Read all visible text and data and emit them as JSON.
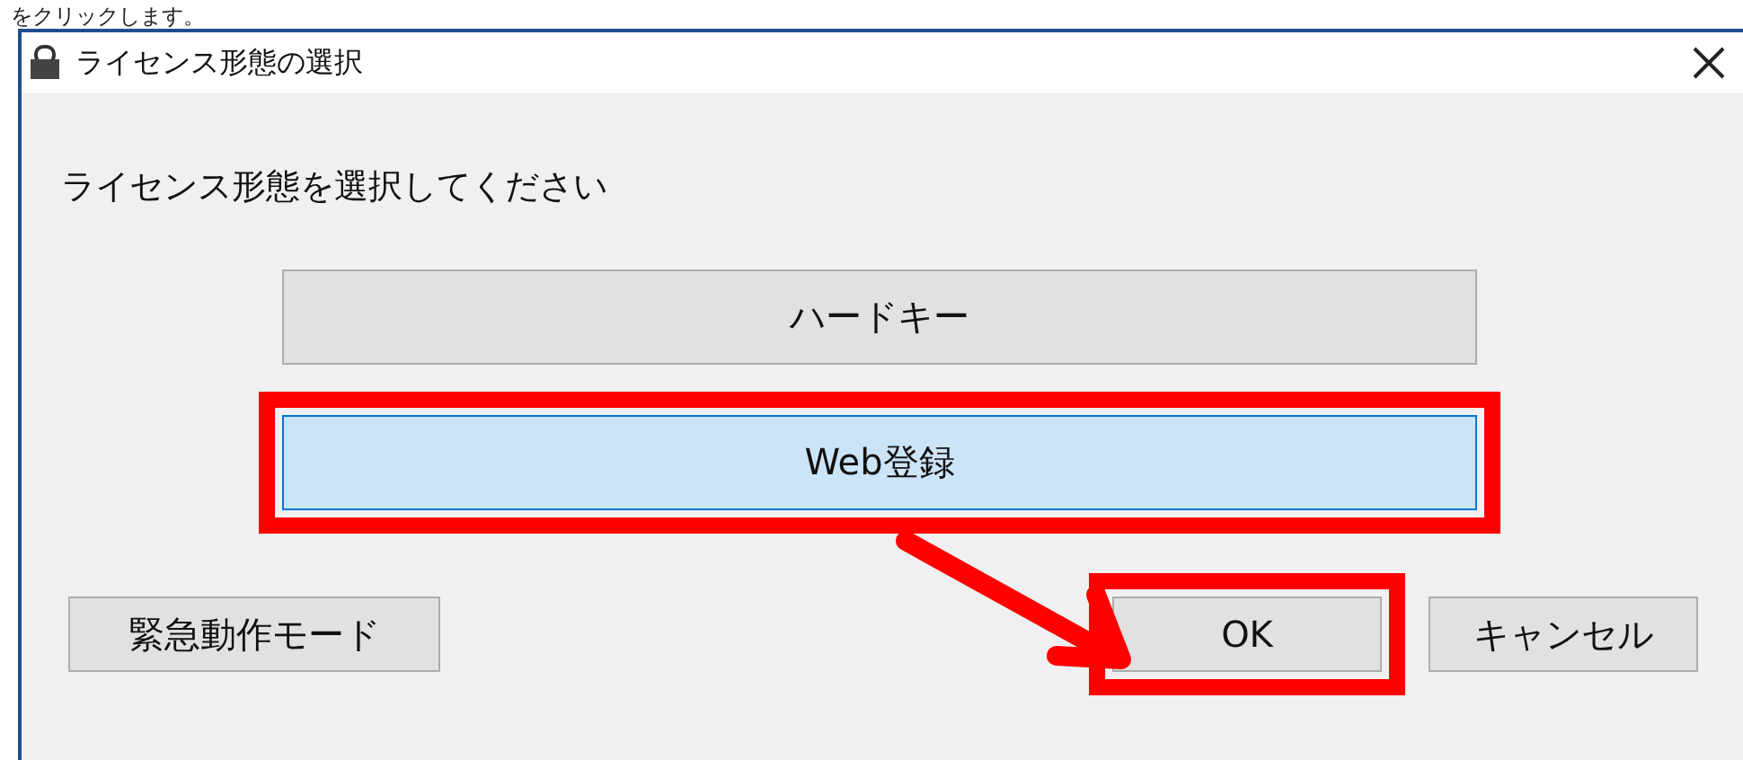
{
  "instruction": "をクリックします。",
  "window": {
    "title": "ライセンス形態の選択"
  },
  "prompt": "ライセンス形態を選択してください",
  "options": [
    {
      "label": "ハードキー",
      "selected": false,
      "highlighted": false
    },
    {
      "label": "Web登録",
      "selected": true,
      "highlighted": true
    }
  ],
  "buttons": [
    {
      "label": "緊急動作モード",
      "kind": "left",
      "highlighted": false
    },
    {
      "label": "OK",
      "kind": "right",
      "highlighted": true
    },
    {
      "label": "キャンセル",
      "kind": "right",
      "highlighted": false
    }
  ]
}
